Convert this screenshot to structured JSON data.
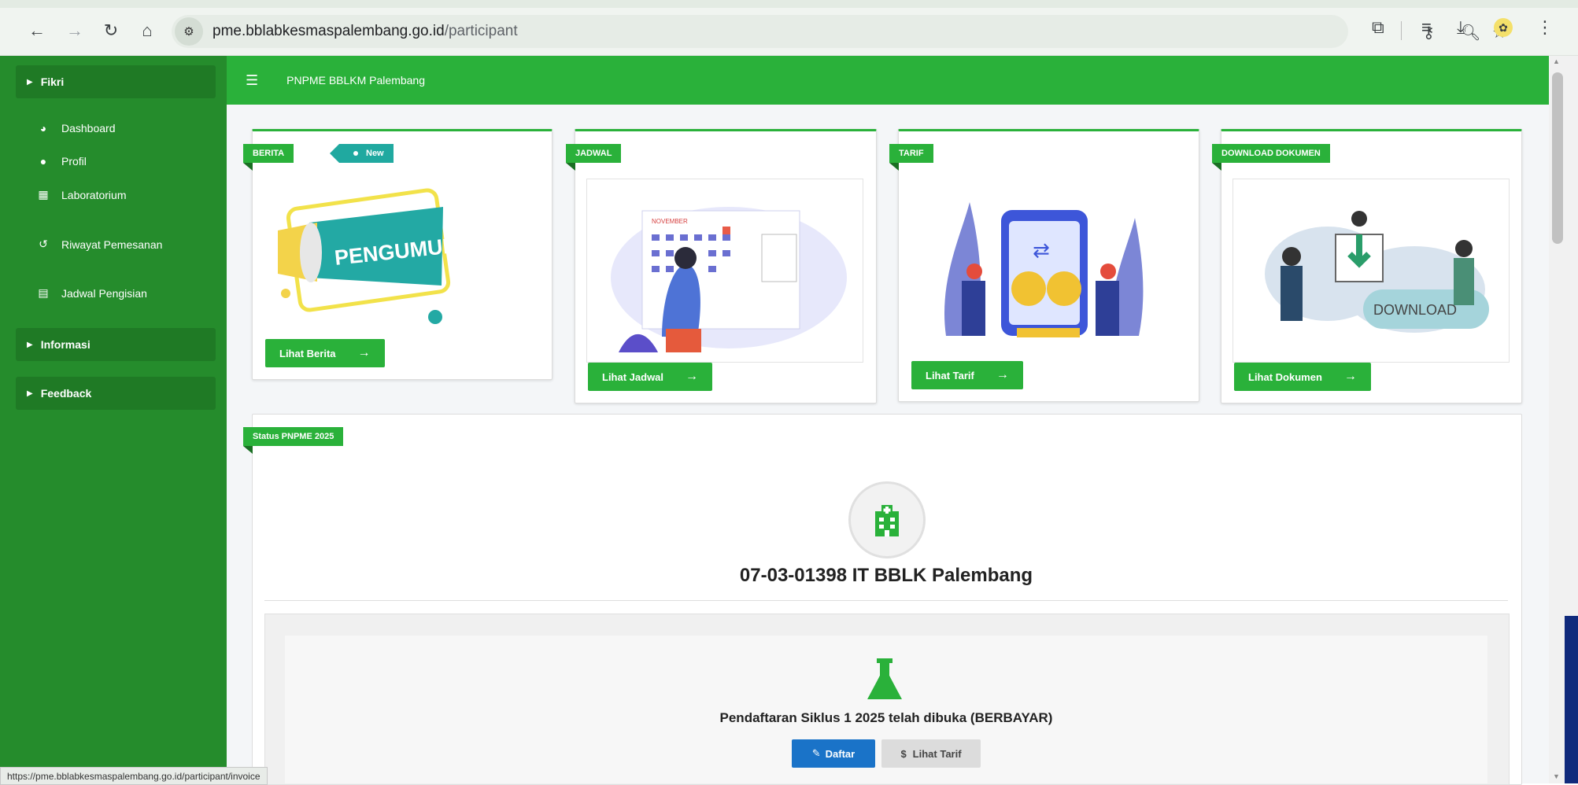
{
  "browser": {
    "url_domain": "pme.bblabkesmaspalembang.go.id",
    "url_path": "/participant",
    "status_url": "https://pme.bblabkesmaspalembang.go.id/participant/invoice"
  },
  "sidebar": {
    "user": "Fikri",
    "items": [
      {
        "label": "Dashboard",
        "icon": "dashboard-icon"
      },
      {
        "label": "Profil",
        "icon": "user-icon"
      },
      {
        "label": "Laboratorium",
        "icon": "building-icon"
      },
      {
        "label": "Riwayat Pemesanan",
        "icon": "history-icon"
      },
      {
        "label": "Jadwal Pengisian",
        "icon": "calendar-icon"
      }
    ],
    "informasi": "Informasi",
    "feedback": "Feedback"
  },
  "topbar": {
    "title": "PNPME BBLKM Palembang"
  },
  "cards": [
    {
      "ribbon": "BERITA",
      "badge": "New",
      "illustration_text": "PENGUMUMAN",
      "button": "Lihat Berita"
    },
    {
      "ribbon": "JADWAL",
      "illustration_text": "NOVEMBER",
      "button": "Lihat Jadwal"
    },
    {
      "ribbon": "TARIF",
      "button": "Lihat Tarif"
    },
    {
      "ribbon": "DOWNLOAD DOKUMEN",
      "illustration_text": "DOWNLOAD",
      "button": "Lihat Dokumen"
    }
  ],
  "status": {
    "ribbon": "Status PNPME 2025",
    "lab_name": "07-03-01398 IT BBLK Palembang",
    "registration_text": "Pendaftaran Siklus 1 2025 telah dibuka (BERBAYAR)",
    "daftar_label": "Daftar",
    "tarif_label": "Lihat Tarif"
  },
  "colors": {
    "primary_green": "#2ab13a",
    "sidebar_green": "#258c2c",
    "teal": "#20a9a0",
    "blue": "#1a73c8"
  }
}
